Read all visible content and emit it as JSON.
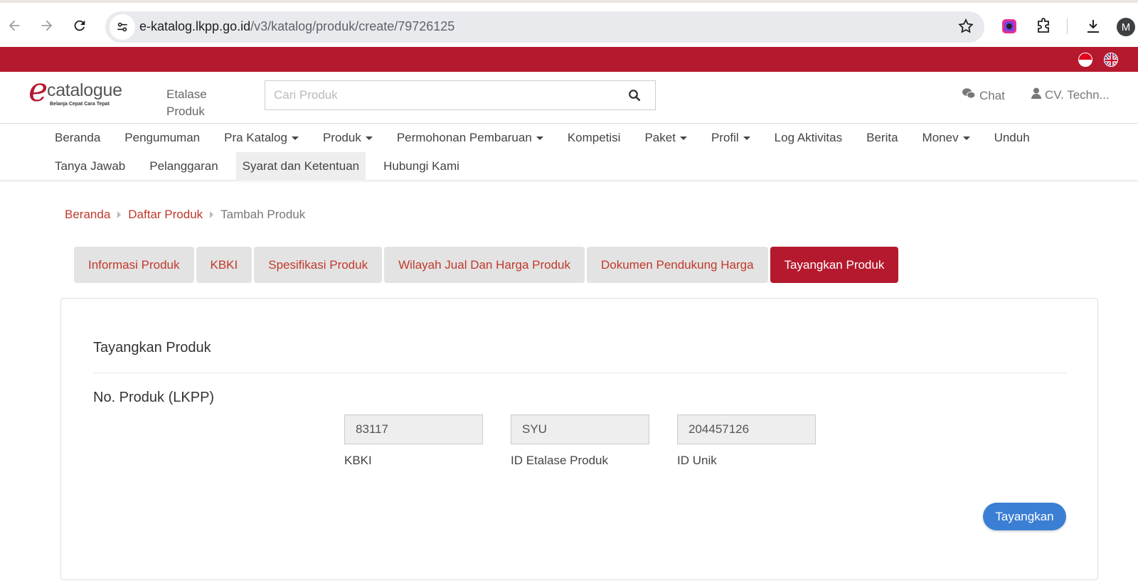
{
  "browser": {
    "url_host": "e-katalog.lkpp.go.id",
    "url_path": "/v3/katalog/produk/create/79726125",
    "profile_initial": "M"
  },
  "header": {
    "logo_word": "catalogue",
    "logo_tagline": "Belanja Cepat Cara Tepat",
    "etalase_label": "Etalase Produk",
    "search_placeholder": "Cari Produk",
    "chat_label": "Chat",
    "user_label": "CV. Techn..."
  },
  "menu": {
    "row1": [
      "Beranda",
      "Pengumuman",
      "Pra Katalog",
      "Produk",
      "Permohonan Pembaruan",
      "Kompetisi",
      "Paket",
      "Profil",
      "Log Aktivitas",
      "Berita",
      "Monev",
      "Unduh"
    ],
    "row2": [
      "Tanya Jawab",
      "Pelanggaran",
      "Syarat dan Ketentuan",
      "Hubungi Kami"
    ]
  },
  "breadcrumb": {
    "home": "Beranda",
    "list": "Daftar Produk",
    "current": "Tambah Produk"
  },
  "tabs": [
    "Informasi Produk",
    "KBKI",
    "Spesifikasi Produk",
    "Wilayah Jual Dan Harga Produk",
    "Dokumen Pendukung Harga",
    "Tayangkan Produk"
  ],
  "panel": {
    "title": "Tayangkan Produk",
    "field_label": "No. Produk (LKPP)",
    "kbki_value": "83117",
    "kbki_caption": "KBKI",
    "etalase_value": "SYU",
    "etalase_caption": "ID Etalase Produk",
    "unik_value": "204457126",
    "unik_caption": "ID Unik",
    "button_label": "Tayangkan"
  },
  "colors": {
    "brand_red": "#b5192e",
    "link_red": "#c0392b",
    "button_blue": "#3b7fd4"
  }
}
